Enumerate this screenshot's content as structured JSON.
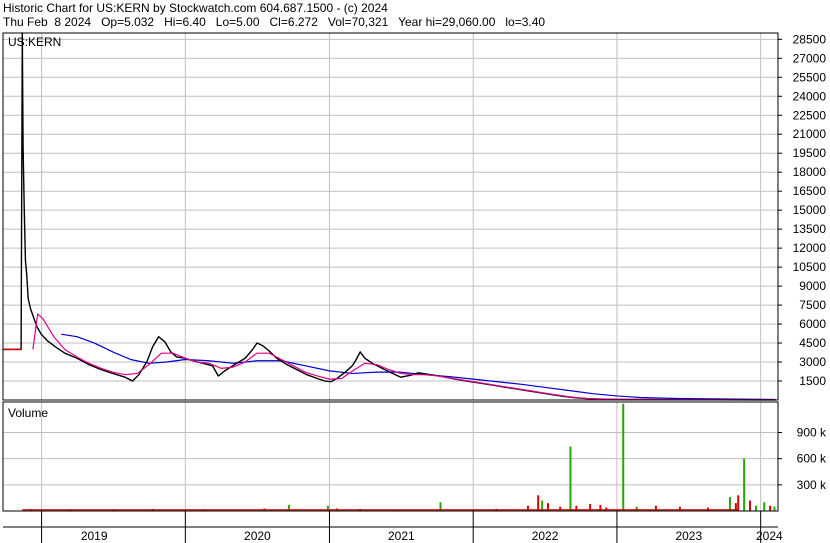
{
  "header": {
    "line1": "Historic Chart for US:KERN by Stockwatch.com 604.687.1500 - (c) 2024",
    "line2": "Thu Feb  8 2024   Op=5.032   Hi=6.40   Lo=5.00   Cl=6.272   Vol=70,321   Year hi=29,060.00   lo=3.40"
  },
  "colors": {
    "price": "#000000",
    "ma_short": "#e0008a",
    "ma_long": "#0000cc",
    "pre_listing": "#d40000",
    "volume_up": "#22aa00",
    "volume_down": "#d40000",
    "grid": "#bfbfbf"
  },
  "chart_data": [
    {
      "type": "line",
      "label": "US:KERN",
      "y_scale": "linear",
      "y_ticks": [
        1500,
        3000,
        4500,
        6000,
        7500,
        9000,
        10500,
        12000,
        13500,
        15000,
        16500,
        18000,
        19500,
        21000,
        22500,
        24000,
        25500,
        27000,
        28500
      ],
      "ylim": [
        0,
        29000
      ],
      "x_ticks": [
        "2019",
        "2020",
        "2021",
        "2022",
        "2023",
        "2024"
      ],
      "xlim": [
        "2018-09-25",
        "2024-02-14"
      ],
      "grid": true,
      "series": [
        {
          "role": "close",
          "points": [
            [
              "2018-09-25",
              4000
            ],
            [
              "2018-11-10",
              4000
            ],
            [
              "2018-11-13",
              29000
            ],
            [
              "2018-11-15",
              20000
            ],
            [
              "2018-11-18",
              15000
            ],
            [
              "2018-11-21",
              11000
            ],
            [
              "2018-11-24",
              10000
            ],
            [
              "2018-11-28",
              8000
            ],
            [
              "2018-12-04",
              7200
            ],
            [
              "2018-12-12",
              6500
            ],
            [
              "2018-12-20",
              5800
            ],
            [
              "2018-12-31",
              5200
            ],
            [
              "2019-01-15",
              4700
            ],
            [
              "2019-02-05",
              4200
            ],
            [
              "2019-03-01",
              3700
            ],
            [
              "2019-04-01",
              3300
            ],
            [
              "2019-05-01",
              2800
            ],
            [
              "2019-06-01",
              2400
            ],
            [
              "2019-07-01",
              2100
            ],
            [
              "2019-08-01",
              1800
            ],
            [
              "2019-08-20",
              1500
            ],
            [
              "2019-09-05",
              2000
            ],
            [
              "2019-09-25",
              3000
            ],
            [
              "2019-10-10",
              4200
            ],
            [
              "2019-10-25",
              5000
            ],
            [
              "2019-11-10",
              4600
            ],
            [
              "2019-11-25",
              3800
            ],
            [
              "2019-12-10",
              3400
            ],
            [
              "2019-12-31",
              3300
            ],
            [
              "2020-01-20",
              3100
            ],
            [
              "2020-02-15",
              2900
            ],
            [
              "2020-03-10",
              2700
            ],
            [
              "2020-03-25",
              1900
            ],
            [
              "2020-04-10",
              2300
            ],
            [
              "2020-05-05",
              2800
            ],
            [
              "2020-06-01",
              3300
            ],
            [
              "2020-06-20",
              4000
            ],
            [
              "2020-07-01",
              4500
            ],
            [
              "2020-07-15",
              4300
            ],
            [
              "2020-07-31",
              3900
            ],
            [
              "2020-08-20",
              3300
            ],
            [
              "2020-09-15",
              2800
            ],
            [
              "2020-10-10",
              2400
            ],
            [
              "2020-11-05",
              2000
            ],
            [
              "2020-12-01",
              1700
            ],
            [
              "2020-12-20",
              1500
            ],
            [
              "2021-01-05",
              1450
            ],
            [
              "2021-01-20",
              1700
            ],
            [
              "2021-02-10",
              2200
            ],
            [
              "2021-02-28",
              2700
            ],
            [
              "2021-03-10",
              3200
            ],
            [
              "2021-03-20",
              3800
            ],
            [
              "2021-04-01",
              3300
            ],
            [
              "2021-04-20",
              2900
            ],
            [
              "2021-05-15",
              2500
            ],
            [
              "2021-06-10",
              2100
            ],
            [
              "2021-07-01",
              1800
            ],
            [
              "2021-07-25",
              1950
            ],
            [
              "2021-08-15",
              2150
            ],
            [
              "2021-09-15",
              2000
            ],
            [
              "2021-10-15",
              1850
            ],
            [
              "2021-11-15",
              1650
            ],
            [
              "2021-12-15",
              1500
            ],
            [
              "2022-01-15",
              1350
            ],
            [
              "2022-02-15",
              1200
            ],
            [
              "2022-03-15",
              1050
            ],
            [
              "2022-04-15",
              900
            ],
            [
              "2022-05-15",
              750
            ],
            [
              "2022-06-15",
              600
            ],
            [
              "2022-07-15",
              450
            ],
            [
              "2022-08-15",
              300
            ],
            [
              "2022-09-15",
              180
            ],
            [
              "2022-10-15",
              110
            ],
            [
              "2022-11-15",
              70
            ],
            [
              "2023-01-01",
              45
            ],
            [
              "2023-06-01",
              25
            ],
            [
              "2024-02-08",
              6.272
            ]
          ]
        },
        {
          "role": "moving-average-short",
          "points": [
            [
              "2018-12-10",
              4000
            ],
            [
              "2018-12-22",
              6800
            ],
            [
              "2019-01-05",
              6400
            ],
            [
              "2019-02-01",
              5000
            ],
            [
              "2019-03-01",
              4000
            ],
            [
              "2019-04-01",
              3400
            ],
            [
              "2019-05-01",
              2900
            ],
            [
              "2019-06-01",
              2500
            ],
            [
              "2019-07-01",
              2200
            ],
            [
              "2019-08-01",
              2000
            ],
            [
              "2019-09-01",
              2100
            ],
            [
              "2019-10-01",
              2800
            ],
            [
              "2019-11-01",
              3700
            ],
            [
              "2019-12-01",
              3700
            ],
            [
              "2020-01-01",
              3300
            ],
            [
              "2020-02-01",
              3000
            ],
            [
              "2020-03-01",
              2900
            ],
            [
              "2020-04-01",
              2500
            ],
            [
              "2020-05-01",
              2600
            ],
            [
              "2020-06-01",
              3000
            ],
            [
              "2020-07-01",
              3700
            ],
            [
              "2020-08-01",
              3700
            ],
            [
              "2020-09-01",
              3200
            ],
            [
              "2020-10-01",
              2700
            ],
            [
              "2020-11-01",
              2200
            ],
            [
              "2020-12-01",
              1900
            ],
            [
              "2021-01-01",
              1650
            ],
            [
              "2021-02-01",
              1700
            ],
            [
              "2021-03-01",
              2300
            ],
            [
              "2021-04-01",
              2900
            ],
            [
              "2021-05-01",
              2800
            ],
            [
              "2021-06-01",
              2400
            ],
            [
              "2021-07-01",
              2100
            ],
            [
              "2021-08-01",
              2000
            ],
            [
              "2021-09-01",
              2000
            ],
            [
              "2021-10-01",
              1900
            ],
            [
              "2021-11-01",
              1750
            ],
            [
              "2021-12-01",
              1600
            ],
            [
              "2022-01-01",
              1450
            ],
            [
              "2022-02-01",
              1300
            ],
            [
              "2022-03-01",
              1150
            ],
            [
              "2022-04-01",
              1000
            ],
            [
              "2022-05-01",
              850
            ],
            [
              "2022-06-01",
              700
            ],
            [
              "2022-07-01",
              550
            ],
            [
              "2022-08-01",
              400
            ],
            [
              "2022-09-01",
              260
            ],
            [
              "2022-10-01",
              160
            ],
            [
              "2022-11-01",
              100
            ],
            [
              "2023-01-01",
              55
            ],
            [
              "2023-06-01",
              30
            ],
            [
              "2024-02-08",
              10
            ]
          ]
        },
        {
          "role": "moving-average-long",
          "points": [
            [
              "2019-02-20",
              5200
            ],
            [
              "2019-04-01",
              5000
            ],
            [
              "2019-05-15",
              4500
            ],
            [
              "2019-07-01",
              3800
            ],
            [
              "2019-08-15",
              3200
            ],
            [
              "2019-10-01",
              2900
            ],
            [
              "2019-11-15",
              3000
            ],
            [
              "2020-01-01",
              3200
            ],
            [
              "2020-03-01",
              3100
            ],
            [
              "2020-05-01",
              2900
            ],
            [
              "2020-07-01",
              3100
            ],
            [
              "2020-09-01",
              3100
            ],
            [
              "2020-11-01",
              2700
            ],
            [
              "2021-01-01",
              2300
            ],
            [
              "2021-03-01",
              2100
            ],
            [
              "2021-05-01",
              2200
            ],
            [
              "2021-07-01",
              2200
            ],
            [
              "2021-09-01",
              2000
            ],
            [
              "2021-11-01",
              1850
            ],
            [
              "2022-01-01",
              1650
            ],
            [
              "2022-03-01",
              1450
            ],
            [
              "2022-05-01",
              1250
            ],
            [
              "2022-07-01",
              1000
            ],
            [
              "2022-09-01",
              750
            ],
            [
              "2022-11-01",
              500
            ],
            [
              "2023-01-01",
              320
            ],
            [
              "2023-03-01",
              200
            ],
            [
              "2023-06-01",
              120
            ],
            [
              "2023-10-01",
              80
            ],
            [
              "2024-02-08",
              40
            ]
          ]
        },
        {
          "role": "pre-listing-reference",
          "points": [
            [
              "2018-09-25",
              4000
            ],
            [
              "2018-11-12",
              4000
            ]
          ]
        }
      ]
    },
    {
      "type": "bar",
      "label": "Volume",
      "y_ticks": [
        300000,
        600000,
        900000
      ],
      "y_tick_labels": [
        "300 k",
        "600 k",
        "900 k"
      ],
      "ylim": [
        0,
        1250000
      ],
      "x_ticks": [
        "2019",
        "2020",
        "2021",
        "2022",
        "2023",
        "2024"
      ],
      "xlim": [
        "2018-09-25",
        "2024-02-14"
      ],
      "grid": true,
      "bars": [
        {
          "date": "2018-12-05",
          "value": 20000,
          "dir": "up"
        },
        {
          "date": "2019-03-15",
          "value": 15000,
          "dir": "down"
        },
        {
          "date": "2019-07-01",
          "value": 12000,
          "dir": "down"
        },
        {
          "date": "2019-10-10",
          "value": 25000,
          "dir": "up"
        },
        {
          "date": "2020-02-20",
          "value": 15000,
          "dir": "down"
        },
        {
          "date": "2020-07-20",
          "value": 30000,
          "dir": "up"
        },
        {
          "date": "2020-09-20",
          "value": 70000,
          "dir": "up"
        },
        {
          "date": "2020-12-28",
          "value": 60000,
          "dir": "up"
        },
        {
          "date": "2021-01-20",
          "value": 30000,
          "dir": "up"
        },
        {
          "date": "2021-03-20",
          "value": 25000,
          "dir": "up"
        },
        {
          "date": "2021-06-15",
          "value": 12000,
          "dir": "down"
        },
        {
          "date": "2021-10-10",
          "value": 100000,
          "dir": "up"
        },
        {
          "date": "2022-03-01",
          "value": 25000,
          "dir": "down"
        },
        {
          "date": "2022-05-20",
          "value": 60000,
          "dir": "down"
        },
        {
          "date": "2022-06-15",
          "value": 180000,
          "dir": "down"
        },
        {
          "date": "2022-06-25",
          "value": 120000,
          "dir": "up"
        },
        {
          "date": "2022-07-10",
          "value": 90000,
          "dir": "down"
        },
        {
          "date": "2022-08-10",
          "value": 50000,
          "dir": "down"
        },
        {
          "date": "2022-09-05",
          "value": 740000,
          "dir": "up"
        },
        {
          "date": "2022-09-20",
          "value": 60000,
          "dir": "down"
        },
        {
          "date": "2022-10-25",
          "value": 80000,
          "dir": "down"
        },
        {
          "date": "2022-11-20",
          "value": 70000,
          "dir": "down"
        },
        {
          "date": "2022-12-05",
          "value": 40000,
          "dir": "down"
        },
        {
          "date": "2023-01-17",
          "value": 1230000,
          "dir": "up"
        },
        {
          "date": "2023-02-20",
          "value": 50000,
          "dir": "up"
        },
        {
          "date": "2023-04-10",
          "value": 60000,
          "dir": "down"
        },
        {
          "date": "2023-06-10",
          "value": 50000,
          "dir": "down"
        },
        {
          "date": "2023-08-20",
          "value": 40000,
          "dir": "down"
        },
        {
          "date": "2023-10-15",
          "value": 160000,
          "dir": "up"
        },
        {
          "date": "2023-10-30",
          "value": 90000,
          "dir": "down"
        },
        {
          "date": "2023-11-05",
          "value": 180000,
          "dir": "down"
        },
        {
          "date": "2023-11-20",
          "value": 600000,
          "dir": "up"
        },
        {
          "date": "2023-12-05",
          "value": 120000,
          "dir": "down"
        },
        {
          "date": "2023-12-20",
          "value": 60000,
          "dir": "up"
        },
        {
          "date": "2024-01-10",
          "value": 100000,
          "dir": "up"
        },
        {
          "date": "2024-01-25",
          "value": 60000,
          "dir": "down"
        },
        {
          "date": "2024-02-05",
          "value": 50000,
          "dir": "up"
        }
      ]
    }
  ]
}
